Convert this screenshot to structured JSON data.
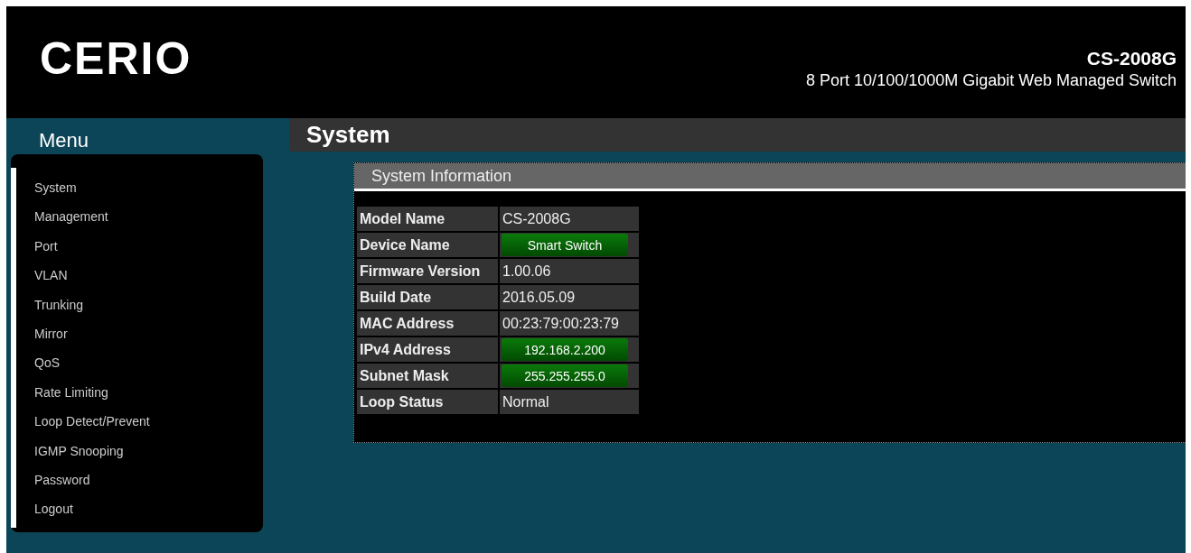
{
  "header": {
    "logo": "CERIO",
    "model": "CS-2008G",
    "description": "8 Port 10/100/1000M Gigabit Web Managed Switch"
  },
  "menu": {
    "title": "Menu",
    "items": [
      {
        "label": "System"
      },
      {
        "label": "Management"
      },
      {
        "label": "Port"
      },
      {
        "label": "VLAN"
      },
      {
        "label": "Trunking"
      },
      {
        "label": "Mirror"
      },
      {
        "label": "QoS"
      },
      {
        "label": "Rate Limiting"
      },
      {
        "label": "Loop Detect/Prevent"
      },
      {
        "label": "IGMP Snooping"
      },
      {
        "label": "Password"
      },
      {
        "label": "Logout"
      }
    ]
  },
  "page_title": "System",
  "panel": {
    "title": "System Information",
    "rows": [
      {
        "label": "Model Name",
        "value": "CS-2008G",
        "kind": "text"
      },
      {
        "label": "Device Name",
        "value": "Smart Switch",
        "kind": "button"
      },
      {
        "label": "Firmware Version",
        "value": "1.00.06",
        "kind": "text"
      },
      {
        "label": "Build Date",
        "value": "2016.05.09",
        "kind": "text"
      },
      {
        "label": "MAC Address",
        "value": "00:23:79:00:23:79",
        "kind": "text"
      },
      {
        "label": "IPv4 Address",
        "value": "192.168.2.200",
        "kind": "button"
      },
      {
        "label": "Subnet Mask",
        "value": "255.255.255.0",
        "kind": "button"
      },
      {
        "label": "Loop Status",
        "value": "Normal",
        "kind": "text"
      }
    ]
  }
}
